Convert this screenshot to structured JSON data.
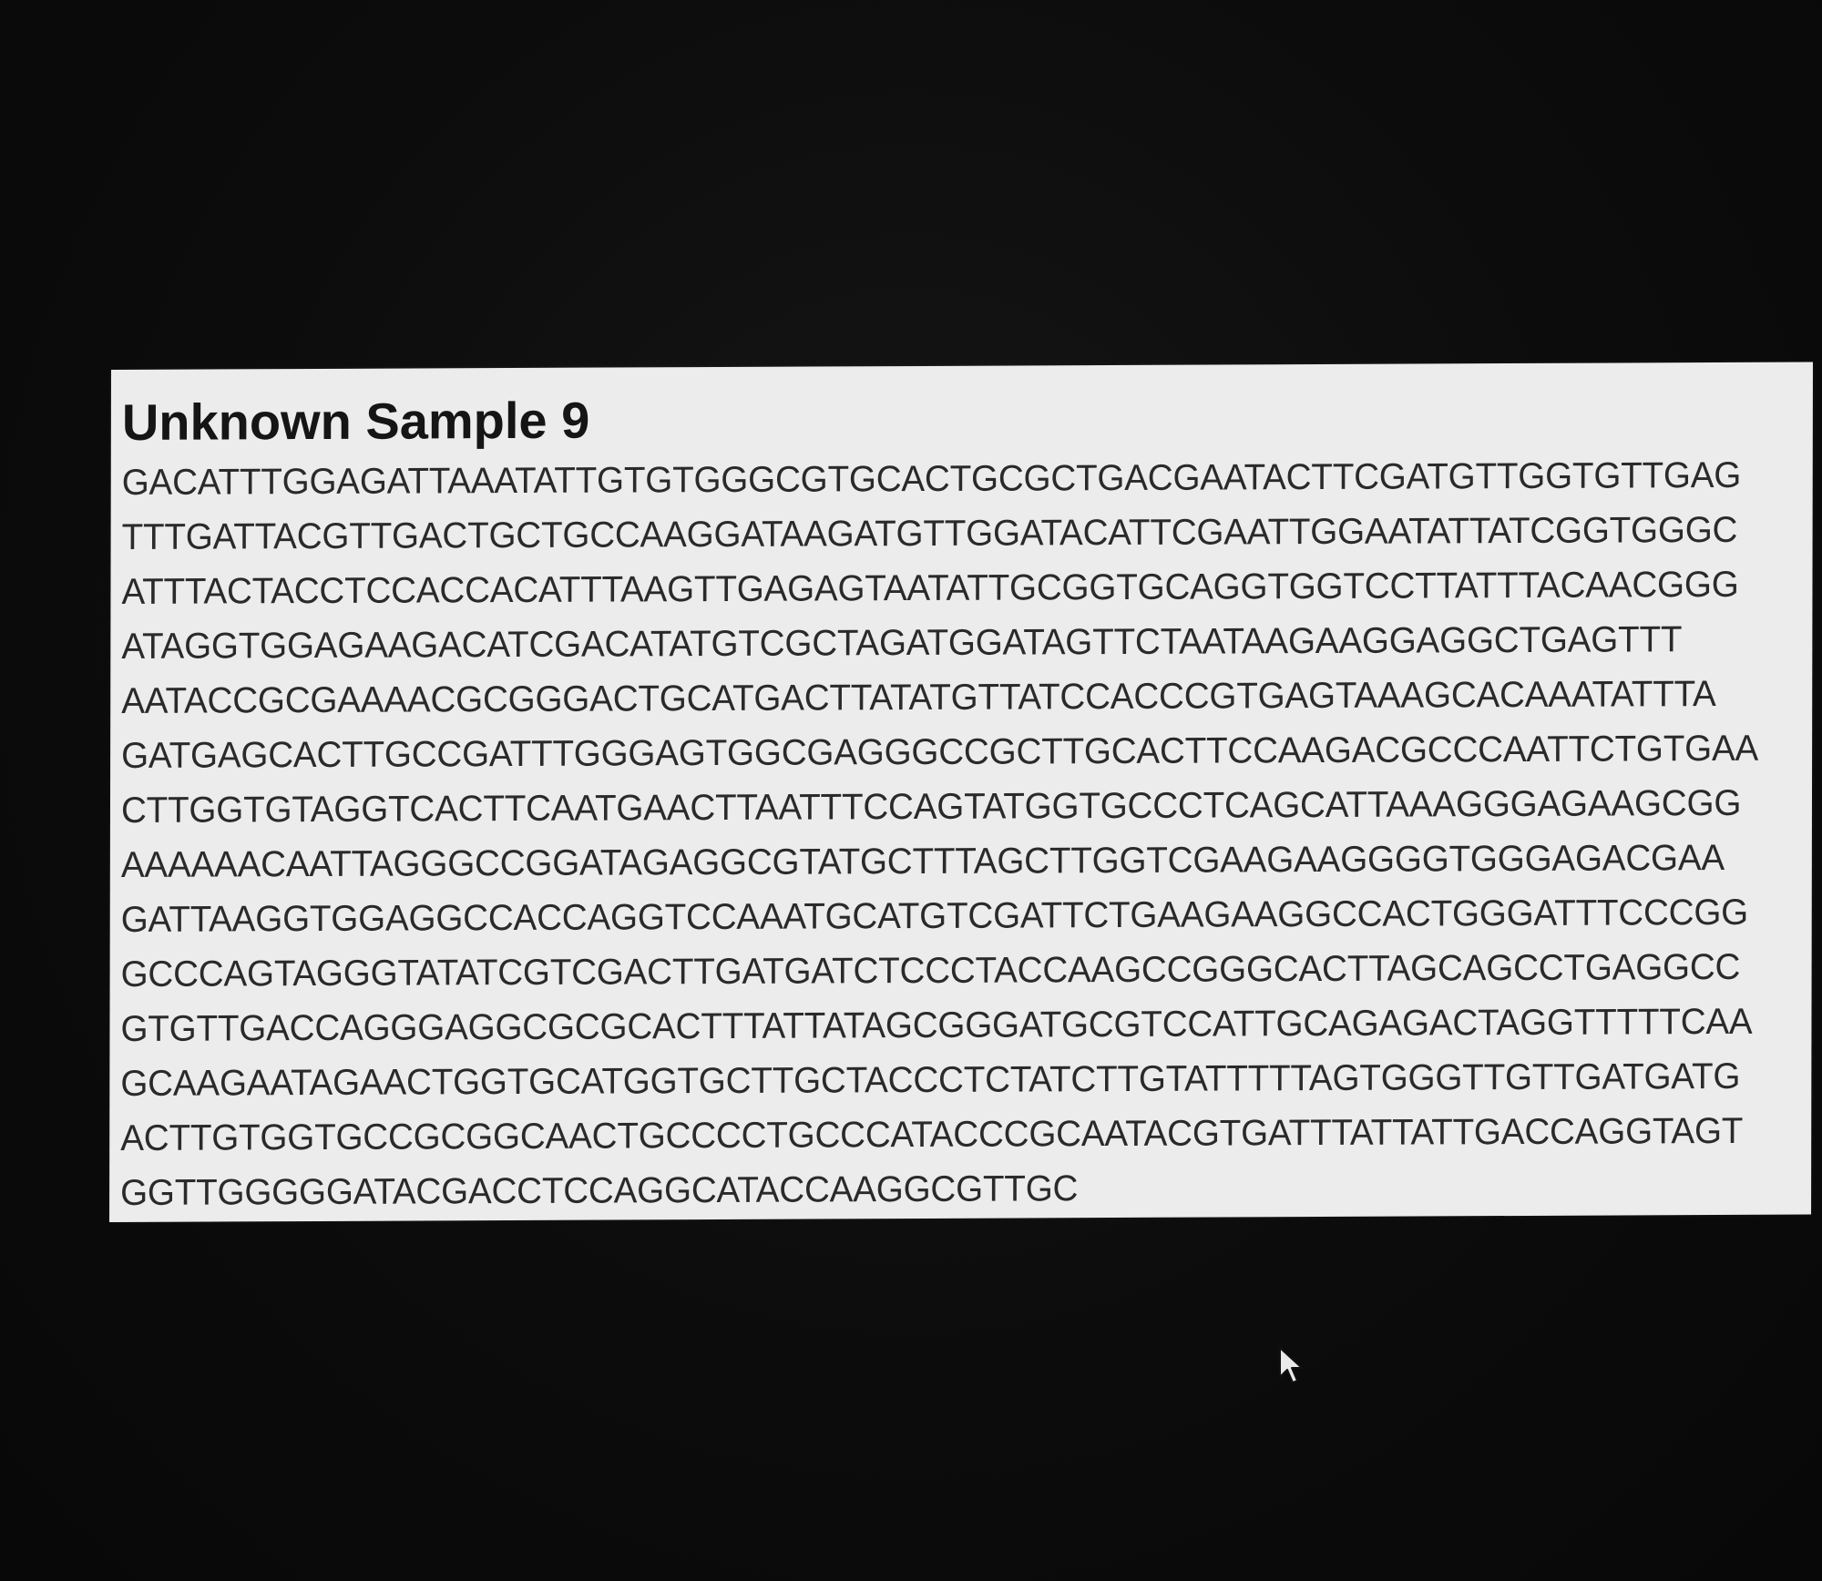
{
  "sample": {
    "title": "Unknown Sample 9",
    "sequence_lines": [
      "GACATTTGGAGATTAAATATTGTGTGGGCGTGCACTGCGCTGACGAATACTTCGATGTTGGTGTTGAG",
      "TTTGATTACGTTGACTGCTGCCAAGGATAAGATGTTGGATACATTCGAATTGGAATATTATCGGTGGGC",
      "ATTTACTACCTCCACCACATTTAAGTTGAGAGTAATATTGCGGTGCAGGTGGTCCTTATTTACAACGGG",
      "ATAGGTGGAGAAGACATCGACATATGTCGCTAGATGGATAGTTCTAATAAGAAGGAGGCTGAGTTT",
      "AATACCGCGAAAACGCGGGACTGCATGACTTATATGTTATCCACCCGTGAGTAAAGCACAAATATTTA",
      "GATGAGCACTTGCCGATTTGGGAGTGGCGAGGGCCGCTTGCACTTCCAAGACGCCCAATTCTGTGAA",
      "CTTGGTGTAGGTCACTTCAATGAACTTAATTTCCAGTATGGTGCCCTCAGCATTAAAGGGAGAAGCGG",
      "AAAAAACAATTAGGGCCGGATAGAGGCGTATGCTTTAGCTTGGTCGAAGAAGGGGTGGGAGACGAA",
      "GATTAAGGTGGAGGCCACCAGGTCCAAATGCATGTCGATTCTGAAGAAGGCCACTGGGATTTCCCGG",
      "GCCCAGTAGGGTATATCGTCGACTTGATGATCTCCCTACCAAGCCGGGCACTTAGCAGCCTGAGGCC",
      "GTGTTGACCAGGGAGGCGCGCACTTTATTATAGCGGGATGCGTCCATTGCAGAGACTAGGTTTTTCAA",
      "GCAAGAATAGAACTGGTGCATGGTGCTTGCTACCCTCTATCTTGTATTTTTAGTGGGTTGTTGATGATG",
      "ACTTGTGGTGCCGCGGCAACTGCCCCTGCCCATACCCGCAATACGTGATTTATTATTGACCAGGTAGT",
      "GGTTGGGGGATACGACCTCCAGGCATACCAAGGCGTTGC"
    ]
  },
  "pointer": {
    "icon": "mouse-pointer-icon"
  }
}
